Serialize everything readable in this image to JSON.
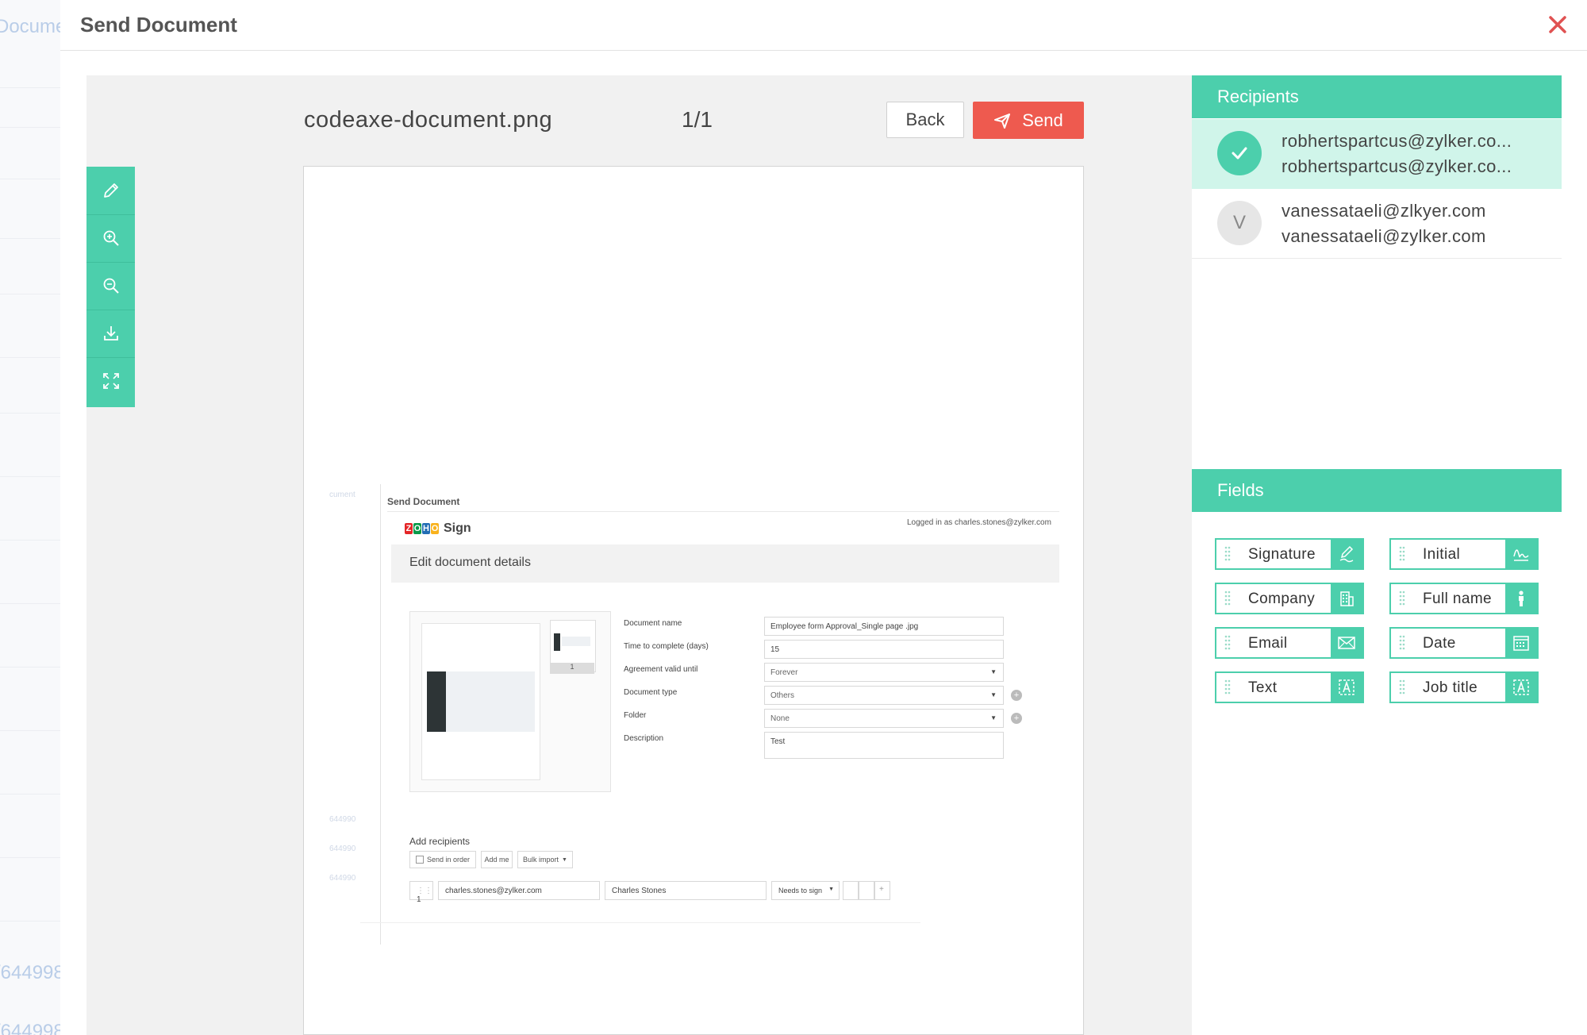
{
  "background": {
    "texts": [
      "Documen",
      "/644998",
      "/644998"
    ]
  },
  "modal": {
    "title": "Send Document",
    "close_icon": "close-icon"
  },
  "preview": {
    "file_name": "codeaxe-document.png",
    "page_counter": "1/1",
    "back_label": "Back",
    "send_label": "Send",
    "tools": [
      "pencil-icon",
      "zoom-in-icon",
      "zoom-out-icon",
      "download-icon",
      "fullscreen-icon"
    ]
  },
  "embedded": {
    "title": "Send Document",
    "logged_in": "Logged in as charles.stones@zylker.com",
    "brand": "Sign",
    "logo_letters": [
      "Z",
      "O",
      "H",
      "O"
    ],
    "section_title": "Edit document details",
    "thumb_page_number": "1",
    "fields": [
      {
        "label": "Document name",
        "value": "Employee form Approval_Single page .jpg",
        "dropdown": false,
        "plus": false
      },
      {
        "label": "Time to complete (days)",
        "value": "15",
        "dropdown": false,
        "plus": false
      },
      {
        "label": "Agreement valid until",
        "value": "Forever",
        "dropdown": true,
        "plus": false
      },
      {
        "label": "Document type",
        "value": "Others",
        "dropdown": true,
        "plus": true
      },
      {
        "label": "Folder",
        "value": "None",
        "dropdown": true,
        "plus": true
      },
      {
        "label": "Description",
        "value": "Test",
        "dropdown": false,
        "plus": false
      }
    ],
    "add_recipients": "Add recipients",
    "send_in_order": "Send in order",
    "add_me": "Add me",
    "bulk_import": "Bulk import",
    "recipient_row": {
      "index": "1",
      "email": "charles.stones@zylker.com",
      "name": "Charles Stones",
      "role": "Needs to sign"
    },
    "faint_left": [
      "cument",
      "644990",
      "644990",
      "644990"
    ]
  },
  "recipients": {
    "header": "Recipients",
    "items": [
      {
        "avatar": "",
        "line1": "robhertspartcus@zylker.co...",
        "line2": "robhertspartcus@zylker.co...",
        "selected": true
      },
      {
        "avatar": "V",
        "line1": "vanessataeli@zlkyer.com",
        "line2": "vanessataeli@zylker.com",
        "selected": false
      }
    ]
  },
  "fields": {
    "header": "Fields",
    "items": [
      {
        "label": "Signature",
        "icon": "signature-icon"
      },
      {
        "label": "Initial",
        "icon": "initial-icon"
      },
      {
        "label": "Company",
        "icon": "company-icon"
      },
      {
        "label": "Full name",
        "icon": "person-icon"
      },
      {
        "label": "Email",
        "icon": "email-icon"
      },
      {
        "label": "Date",
        "icon": "calendar-icon"
      },
      {
        "label": "Text",
        "icon": "text-icon"
      },
      {
        "label": "Job title",
        "icon": "text-icon"
      }
    ]
  },
  "colors": {
    "accent": "#4ccfac",
    "send": "#ee5a4f",
    "selected_row": "#d0f5ea",
    "close": "#e05252"
  }
}
